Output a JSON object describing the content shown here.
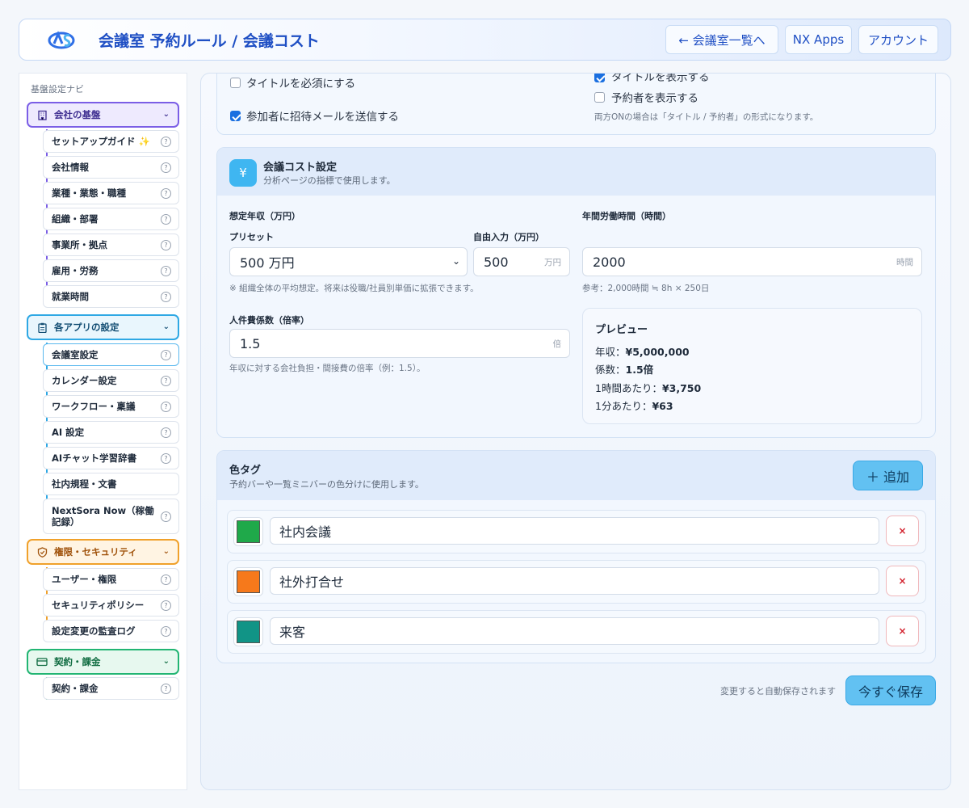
{
  "header": {
    "title": "会議室 予約ルール / 会議コスト",
    "back_label": "← 会議室一覧へ",
    "apps_label": "NX Apps",
    "account_label": "アカウント"
  },
  "sidebar": {
    "nav_title": "基盤設定ナビ",
    "groups": [
      {
        "label": "会社の基盤",
        "icon": "building-icon",
        "color": "#7b5ee6",
        "items": [
          "セットアップガイド ✨",
          "会社情報",
          "業種・業態・職種",
          "組織・部署",
          "事業所・拠点",
          "雇用・労務",
          "就業時間"
        ]
      },
      {
        "label": "各アプリの設定",
        "icon": "clipboard-icon",
        "color": "#2ea8e4",
        "items": [
          "会議室設定",
          "カレンダー設定",
          "ワークフロー・稟議",
          "AI 設定",
          "AIチャット学習辞書",
          "社内規程・文書",
          "NextSora Now（稼働記録）"
        ]
      },
      {
        "label": "権限・セキュリティ",
        "icon": "shield-icon",
        "color": "#f0a12b",
        "items": [
          "ユーザー・権限",
          "セキュリティポリシー",
          "設定変更の監査ログ"
        ]
      },
      {
        "label": "契約・課金",
        "icon": "credit-card-icon",
        "color": "#22b573",
        "items": [
          "契約・課金"
        ]
      }
    ],
    "active_item": "会議室設定"
  },
  "display_options": {
    "require_title": {
      "label": "タイトルを必須にする",
      "checked": false
    },
    "send_invite": {
      "label": "参加者に招待メールを送信する",
      "checked": true
    },
    "show_title": {
      "label": "タイトルを表示する",
      "checked": true
    },
    "show_booker": {
      "label": "予約者を表示する",
      "checked": false
    },
    "note": "両方ONの場合は「タイトル / 予約者」の形式になります。"
  },
  "cost": {
    "icon": "yen-icon",
    "title": "会議コスト設定",
    "subtitle": "分析ページの指標で使用します。",
    "salary_label": "想定年収（万円）",
    "preset_label": "プリセット",
    "preset_value": "500 万円",
    "free_label": "自由入力（万円）",
    "free_value": "500",
    "free_unit": "万円",
    "salary_note": "※ 組織全体の平均想定。将来は役職/社員別単価に拡張できます。",
    "hours_label": "年間労働時間（時間）",
    "hours_value": "2000",
    "hours_unit": "時間",
    "hours_note": "参考：2,000時間 ≒ 8h × 250日",
    "coef_label": "人件費係数（倍率）",
    "coef_value": "1.5",
    "coef_unit": "倍",
    "coef_note": "年収に対する会社負担・間接費の倍率（例：1.5）。",
    "preview": {
      "title": "プレビュー",
      "annual_label": "年収：",
      "annual_value": "¥5,000,000",
      "coef_label": "係数：",
      "coef_value": "1.5倍",
      "hourly_label": "1時間あたり：",
      "hourly_value": "¥3,750",
      "minute_label": "1分あたり：",
      "minute_value": "¥63"
    }
  },
  "tags": {
    "title": "色タグ",
    "subtitle": "予約バーや一覧ミニバーの色分けに使用します。",
    "add_label": "＋ 追加",
    "delete_label": "×",
    "items": [
      {
        "name": "社内会議",
        "color": "#1fa94a"
      },
      {
        "name": "社外打合せ",
        "color": "#f6791b"
      },
      {
        "name": "来客",
        "color": "#119486"
      }
    ]
  },
  "footer": {
    "autosave_note": "変更すると自動保存されます",
    "save_label": "今すぐ保存"
  }
}
